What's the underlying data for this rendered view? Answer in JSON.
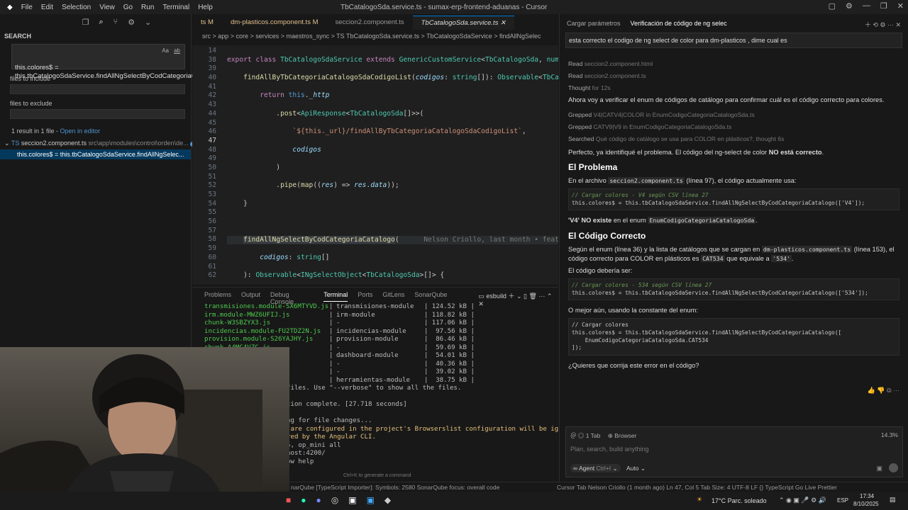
{
  "menu": [
    "File",
    "Edit",
    "Selection",
    "View",
    "Go",
    "Run",
    "Terminal",
    "Help"
  ],
  "window_title": "TbCatalogoSda.service.ts - sumax-erp-frontend-aduanas - Cursor",
  "sidebar": {
    "title": "SEARCH",
    "query": "this.colores$ = this.tbCatalogoSdaService.findAllNgSelectByCodCategoriaCatalogo(['V4']);",
    "toggle_case": "Aa",
    "toggle_word": "ab",
    "include_label": "files to include",
    "exclude_label": "files to exclude",
    "result_summary": "1 result in 1 file - ",
    "open_editor": "Open in editor",
    "file": "seccion2.component.ts",
    "file_path": "src\\app\\modules\\control\\orden\\de...",
    "file_badge": "1",
    "match": "this.colores$ = this.tbCatalogoSdaService.findAllNgSelec..."
  },
  "tabs": [
    {
      "label": "ts M"
    },
    {
      "label": "dm-plasticos.component.ts M"
    },
    {
      "label": "seccion2.component.ts"
    },
    {
      "label": "TbCatalogoSda.service.ts"
    }
  ],
  "breadcrumb": "src > app > core > services > maestros_sync > TS TbCatalogoSda.service.ts > TbCatalogoSdaService > findAllNgSelec",
  "editor": {
    "line_numbers": [
      "14",
      "38",
      "39",
      "40",
      "41",
      "42",
      "43",
      "44",
      "45",
      "46",
      "47",
      "48",
      "49",
      "50",
      "51",
      "52",
      "53",
      "54",
      "55",
      "56",
      "57",
      "58",
      "59",
      "60",
      "61",
      "62"
    ],
    "blame": "Nelson Criollo, last month • feat: (CU-86a"
  },
  "panel_tabs": [
    "Problems",
    "Output",
    "Debug Console",
    "Terminal",
    "Ports",
    "GitLens",
    "SonarQube"
  ],
  "panel_task": "esbuild",
  "terminal": [
    [
      "transmisiones.module-SX6MTYVD.js",
      "transmisiones-module",
      "124.52 kB"
    ],
    [
      "irm.module-MWZ6UFIJ.js",
      "irm-module",
      "118.82 kB"
    ],
    [
      "chunk-W3SBZYX3.js",
      "-",
      "117.06 kB"
    ],
    [
      "incidencias.module-FU2TDZ2N.js",
      "incidencias-module",
      "97.56 kB"
    ],
    [
      "provision.module-S26YAJHY.js",
      "provision-module",
      "86.46 kB"
    ],
    [
      "chunk-A4MC4VZC.js",
      "-",
      "59.69 kB"
    ],
    [
      "js",
      "dashboard-module",
      "54.01 kB"
    ],
    [
      "",
      "-",
      "40.36 kB"
    ],
    [
      "",
      "-",
      "39.02 kB"
    ],
    [
      "CA.js",
      "herramientas-module",
      "38.75 kB"
    ]
  ],
  "terminal_tail": [
    "files. Use \"--verbose\" to show all the files.",
    "",
    "tion complete. [27.718 seconds]",
    "",
    "ng for file changes...",
    " are configured in the project's Browserslist configuration will be ignored as",
    "red by the Angular CLI.",
    "5, op_mini all",
    "host:4200/",
    "ow help"
  ],
  "terminal_hint": "Ctrl+K to generate a command",
  "status": {
    "left": "narQube  [TypeScript Importer]: Symbols: 2580   SonarQube focus: overall code",
    "right": "Cursor Tab    Nelson Criollo (1 month ago)   Ln 47, Col 5   Tab Size: 4   UTF-8   LF   {} TypeScript   Go Live   Prettier"
  },
  "chat": {
    "tabs": [
      "Cargar parámetros",
      "Verificación de código de ng selec"
    ],
    "question": "esta correcto el codigo de ng select de color para dm-plasticos , dime cual es",
    "steps": [
      [
        "Read",
        "seccion2.component.html"
      ],
      [
        "Read",
        "seccion2.component.ts"
      ],
      [
        "Thought",
        "for 12s"
      ]
    ],
    "p1": "Ahora voy a verificar el enum de códigos de catálogo para confirmar cuál es el código correcto para colores.",
    "steps2": [
      [
        "Grepped",
        "V4|CATV4|COLOR in EnumCodigoCategoriaCatalogoSda.ts"
      ],
      [
        "Grepped",
        "CATV9|V9 in EnumCodigoCategoriaCatalogoSda.ts"
      ],
      [
        "Searched",
        "Qué código de catálogo se usa para COLOR en plásticos?, thought 6s"
      ]
    ],
    "p2a": "Perfecto, ya identifiqué el problema. El código del ng-select de color ",
    "p2b": "NO está correcto",
    "h1": "El Problema",
    "p3a": "En el archivo ",
    "p3code": "seccion2.component.ts",
    "p3b": " (línea 97), el código actualmente usa:",
    "code1c": "// Cargar colores - V4 según CSV línea 27",
    "code1": "this.colores$ = this.tbCatalogoSdaService.findAllNgSelectByCodCategoriaCatalogo(['V4']);",
    "p4a": "'V4' NO existe",
    "p4b": " en el enum ",
    "p4code": "EnumCodigoCategoriaCatalogoSda",
    "h2": "El Código Correcto",
    "p5a": "Según el enum (línea 36) y la lista de catálogos que se cargan en ",
    "p5code": "dm-plasticos.component.ts",
    "p5b": " (línea 153), el código correcto para COLOR en plásticos es ",
    "p5code2": "CAT534",
    "p5c": " que equivale a ",
    "p5code3": "'534'",
    "p6": "El código debería ser:",
    "code2c": "// Cargar colores - 534 según CSV línea 27",
    "code2": "this.colores$ = this.tbCatalogoSdaService.findAllNgSelectByCodCategoriaCatalogo(['534']);",
    "p7": "O mejor aún, usando la constante del enum:",
    "code3": "// Cargar colores\nthis.colores$ = this.tbCatalogoSdaService.findAllNgSelectByCodCategoriaCatalogo([\n    EnumCodigoCategoriaCatalogoSda.CAT534\n]);",
    "p8": "¿Quieres que corrija este error en el código?",
    "context_tab": "1 Tab",
    "context_browser": "Browser",
    "context_pct": "14.3%",
    "input_placeholder": "Plan, search, build anything",
    "agent": "Agent",
    "agent_kbd": "Ctrl+I",
    "model": "Auto"
  },
  "taskbar": {
    "weather": "17°C  Parc. soleado",
    "lang": "ESP",
    "time": "17:34",
    "date": "8/10/2025"
  }
}
